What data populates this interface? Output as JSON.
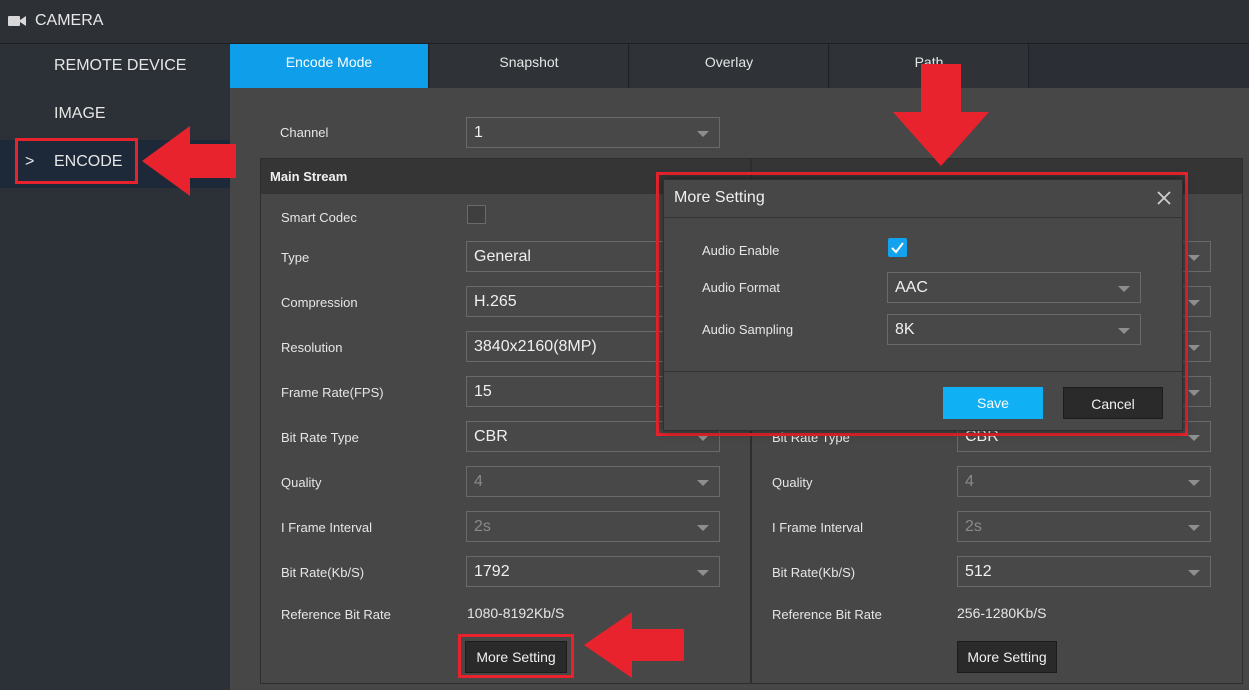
{
  "header": {
    "title": "CAMERA",
    "icon": "camera-icon"
  },
  "sidebar": {
    "items": [
      {
        "label": "REMOTE DEVICE"
      },
      {
        "label": "IMAGE"
      },
      {
        "label": "ENCODE",
        "chevron": ">"
      }
    ]
  },
  "tabs": [
    {
      "label": "Encode Mode"
    },
    {
      "label": "Snapshot"
    },
    {
      "label": "Overlay"
    },
    {
      "label": "Path"
    }
  ],
  "channel": {
    "label": "Channel",
    "value": "1"
  },
  "main_stream": {
    "title": "Main Stream",
    "smart_codec_label": "Smart Codec",
    "rows": [
      {
        "label": "Type",
        "value": "General"
      },
      {
        "label": "Compression",
        "value": "H.265"
      },
      {
        "label": "Resolution",
        "value": "3840x2160(8MP)"
      },
      {
        "label": "Frame Rate(FPS)",
        "value": "15"
      },
      {
        "label": "Bit Rate Type",
        "value": "CBR"
      },
      {
        "label": "Quality",
        "value": "4"
      },
      {
        "label": "I Frame Interval",
        "value": "2s"
      },
      {
        "label": "Bit Rate(Kb/S)",
        "value": "1792"
      }
    ],
    "ref_label": "Reference Bit Rate",
    "ref_value": "1080-8192Kb/S",
    "more_button": "More Setting"
  },
  "sub_stream": {
    "rows": [
      {
        "label": "Bit Rate Type",
        "value": "CBR"
      },
      {
        "label": "Quality",
        "value": "4"
      },
      {
        "label": "I Frame Interval",
        "value": "2s"
      },
      {
        "label": "Bit Rate(Kb/S)",
        "value": "512"
      }
    ],
    "ref_label": "Reference Bit Rate",
    "ref_value": "256-1280Kb/S",
    "more_button": "More Setting"
  },
  "modal": {
    "title": "More Setting",
    "audio_enable_label": "Audio Enable",
    "audio_enable_checked": true,
    "audio_format_label": "Audio Format",
    "audio_format_value": "AAC",
    "audio_sampling_label": "Audio Sampling",
    "audio_sampling_value": "8K",
    "save_label": "Save",
    "cancel_label": "Cancel"
  },
  "colors": {
    "accent": "#0f9ee9",
    "annotation": "#e8232d",
    "panel": "#474747"
  }
}
